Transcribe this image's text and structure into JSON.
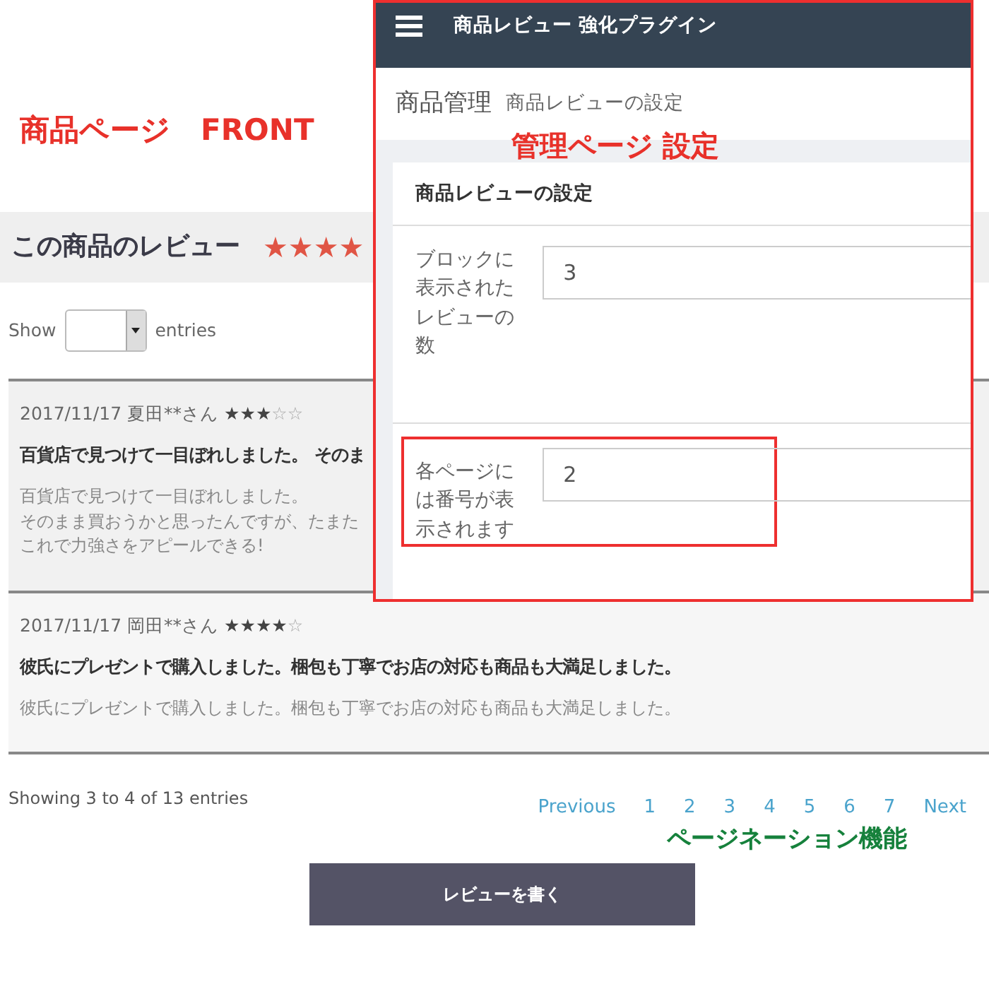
{
  "front_label": "商品ページ　FRONT",
  "front": {
    "heading": "この商品のレビュー",
    "heading_stars": "★★★★",
    "show_label": "Show",
    "entries_label": "entries",
    "reviews": [
      {
        "meta": "2017/11/17 夏田**さん",
        "stars": 3,
        "title": "百貨店で見つけて一目ぼれしました。 そのま",
        "body": [
          "百貨店で見つけて一目ぼれしました。",
          "そのまま買おうかと思ったんですが、たまた",
          "これで力強さをアピールできる!"
        ]
      },
      {
        "meta": "2017/11/17 岡田**さん",
        "stars": 4,
        "title": "彼氏にプレゼントで購入しました。梱包も丁寧でお店の対応も商品も大満足しました。",
        "body": [
          "彼氏にプレゼントで購入しました。梱包も丁寧でお店の対応も商品も大満足しました。"
        ]
      }
    ],
    "info": "Showing 3 to 4 of 13 entries",
    "pages": [
      "Previous",
      "1",
      "2",
      "3",
      "4",
      "5",
      "6",
      "7",
      "Next"
    ],
    "pagination_label": "ページネーション機能",
    "write_button": "レビューを書く"
  },
  "admin": {
    "title": "商品レビュー 強化プラグイン",
    "breadcrumb_main": "商品管理",
    "breadcrumb_sub": "商品レビューの設定",
    "overlay_label": "管理ページ 設定",
    "card_title": "商品レビューの設定",
    "settings": [
      {
        "label": "ブロックに表示されたレビューの数",
        "value": "3",
        "highlighted": false
      },
      {
        "label": "各ページには番号が表示されます",
        "value": "2",
        "highlighted": true
      }
    ]
  }
}
